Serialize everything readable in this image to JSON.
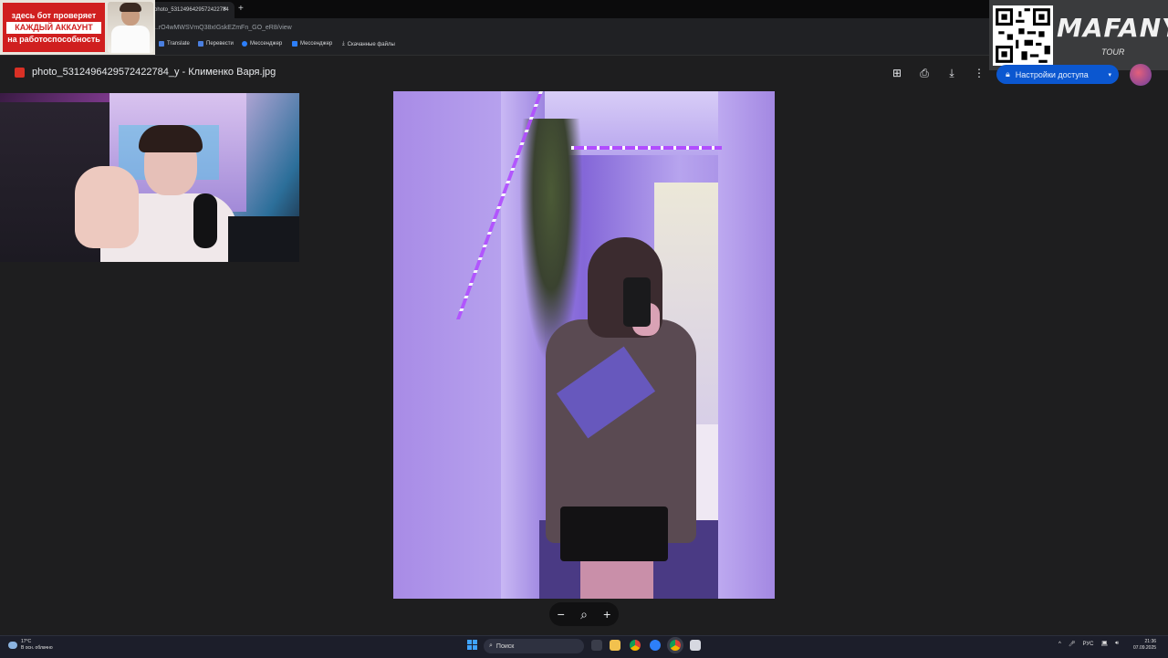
{
  "browser": {
    "tab_title": "photo_5312496429572422784",
    "tab_close": "×",
    "new_tab": "+",
    "url": "...rO4wMWSVmQ38xIGskEZmFn_GO_eR8/view",
    "bookmarks": [
      {
        "label": "Translate",
        "color": "#4a7fe0"
      },
      {
        "label": "Перевести",
        "color": "#4a7fe0"
      },
      {
        "label": "Мессенджер",
        "color": "#2d7ff9"
      },
      {
        "label": "Мессенджер",
        "color": "#2d7ff9"
      },
      {
        "label": "Скачанные файлы",
        "color": "#d6d8db"
      }
    ]
  },
  "overlay_promo": {
    "line1": "здесь бот проверяет",
    "line2": "КАЖДЫЙ АККАУНТ",
    "line3": "на работоспособность"
  },
  "overlay_brand": {
    "name": "MAFANYA",
    "sub": "TOUR"
  },
  "viewer": {
    "file_title": "photo_5312496429572422784_y - Клименко Варя.jpg",
    "share_label": "Настройки доступа",
    "share_dropdown": "▾",
    "icons": {
      "add": "⊞",
      "print": "⎙",
      "download": "⤓",
      "more": "⋮"
    }
  },
  "zoom": {
    "minus": "−",
    "magnifier": "⌕",
    "plus": "+"
  },
  "taskbar": {
    "temperature": "17°C",
    "weather": "В осн. облачно",
    "search_placeholder": "Поиск",
    "language": "РУС",
    "time": "21:36",
    "date": "07.09.2025"
  },
  "colors": {
    "accent": "#0b57d0",
    "viewer_bg": "#1e1e1f",
    "promo_red": "#d01f1f"
  }
}
